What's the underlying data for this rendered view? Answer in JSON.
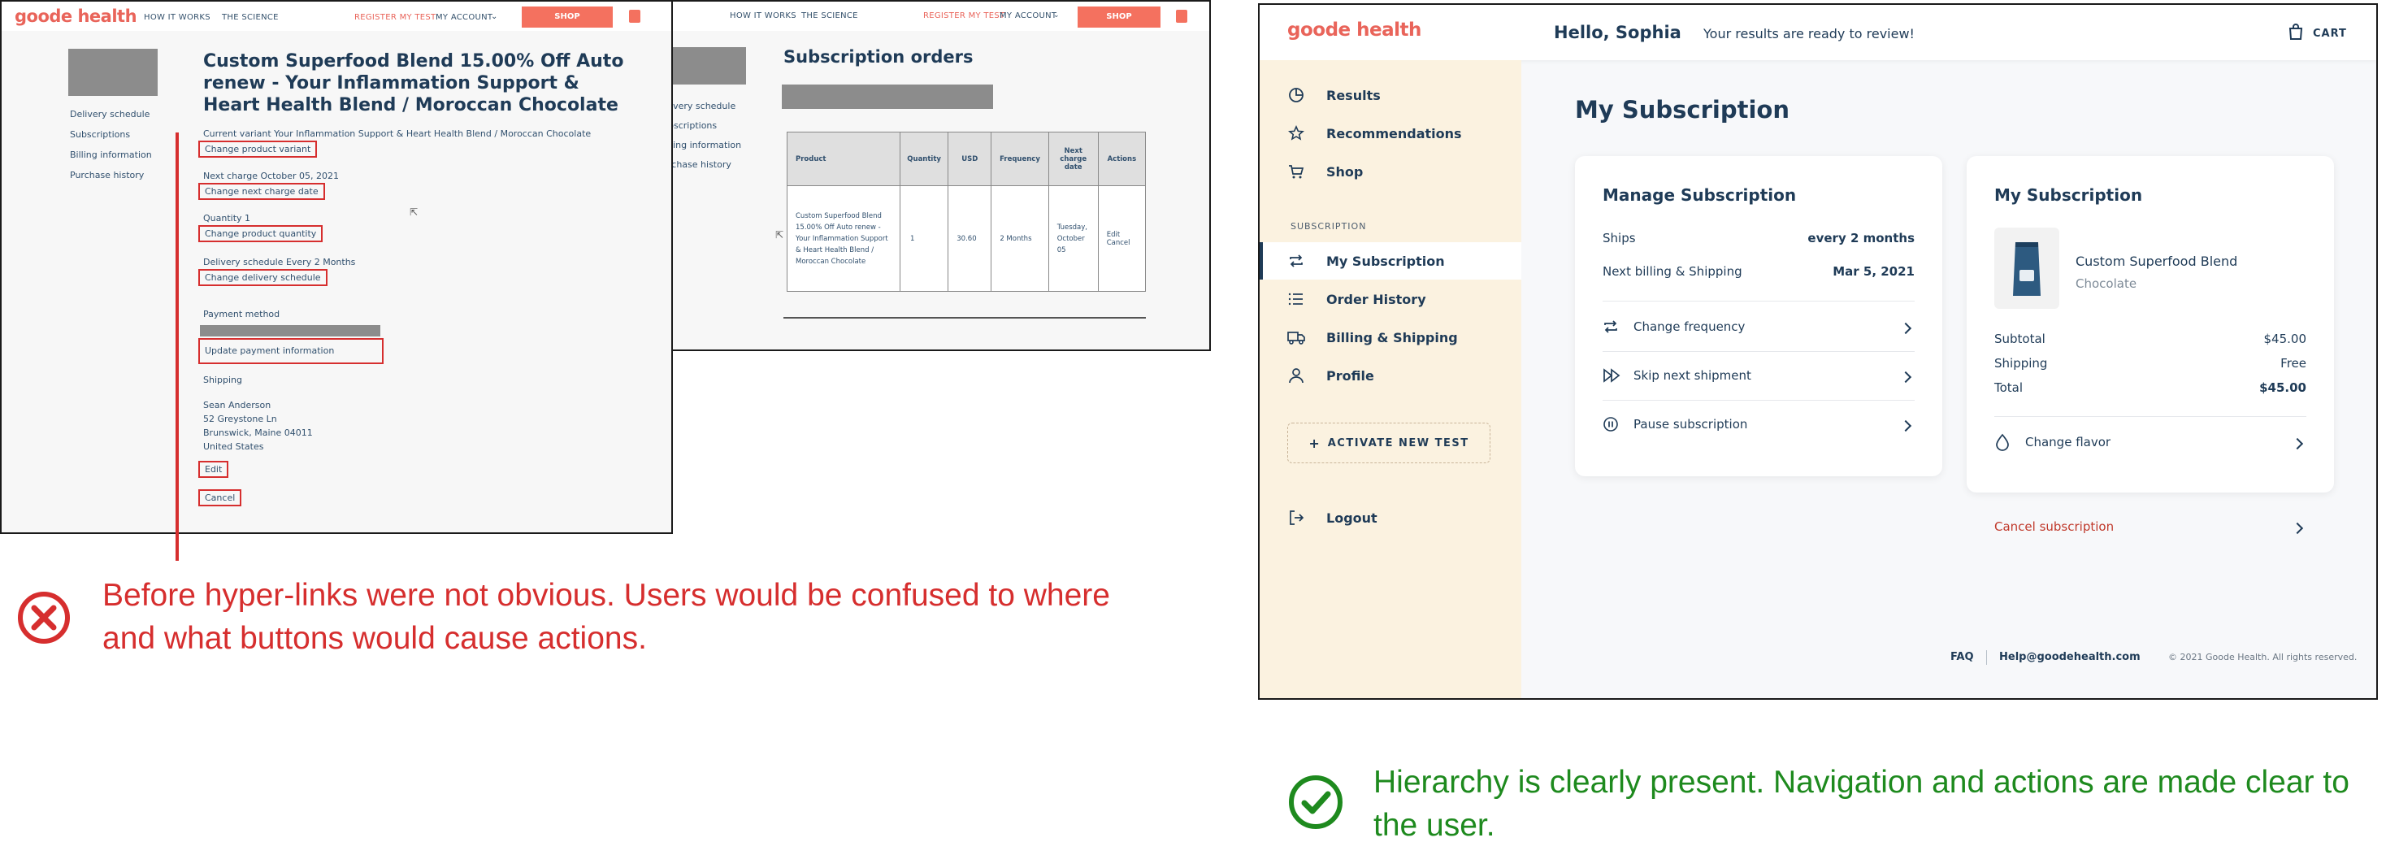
{
  "old_design": {
    "logo": "goode health",
    "nav": [
      "HOW IT WORKS",
      "THE SCIENCE"
    ],
    "register": "REGISTER MY TEST",
    "account": "MY ACCOUNT",
    "shop": "SHOP",
    "sidebar": [
      "Delivery schedule",
      "Subscriptions",
      "Billing information",
      "Purchase history"
    ],
    "sidebar_partial": [
      "livery schedule",
      "bscriptions",
      "lling information",
      "rchase history"
    ],
    "product_title": "Custom Superfood Blend 15.00% Off Auto renew - Your Inflammation Support & Heart Health Blend / Moroccan Chocolate",
    "current_variant": "Current variant Your Inflammation Support & Heart Health Blend / Moroccan Chocolate",
    "change_variant": "Change product variant",
    "next_charge": "Next charge October 05, 2021",
    "change_charge": "Change next charge date",
    "quantity": "Quantity 1",
    "change_quantity": "Change product quantity",
    "delivery": "Delivery schedule Every 2 Months",
    "change_delivery": "Change delivery schedule",
    "payment_label": "Payment method",
    "update_payment": "Update payment information",
    "shipping_label": "Shipping",
    "address": [
      "Sean Anderson",
      "52 Greystone Ln",
      "Brunswick, Maine 04011",
      "United States"
    ],
    "edit": "Edit",
    "cancel": "Cancel",
    "orders_title": "Subscription orders",
    "table": {
      "headers": [
        "Product",
        "Quantity",
        "USD",
        "Frequency",
        "Next charge date",
        "Actions"
      ],
      "row": {
        "product": "Custom Superfood Blend 15.00% Off Auto renew - Your Inflammation Support & Heart Health Blend / Moroccan Chocolate",
        "quantity": "1",
        "usd": "30.60",
        "frequency": "2 Months",
        "next_charge": "Tuesday, October 05",
        "action_edit": "Edit",
        "action_cancel": "Cancel"
      }
    },
    "caption": "Before hyper-links were not obvious. Users would be confused to where and what buttons would cause actions."
  },
  "new_design": {
    "logo": "goode health",
    "greeting": "Hello, Sophia",
    "results_msg": "Your results are ready to review!",
    "cart": "CART",
    "nav": {
      "results": "Results",
      "recommendations": "Recommendations",
      "shop": "Shop",
      "section": "SUBSCRIPTION",
      "my_subscription": "My Subscription",
      "order_history": "Order History",
      "billing": "Billing & Shipping",
      "profile": "Profile",
      "activate": "ACTIVATE NEW TEST",
      "logout": "Logout"
    },
    "page_title": "My Subscription",
    "manage": {
      "title": "Manage Subscription",
      "ships_label": "Ships",
      "ships_value": "every 2 months",
      "next_label": "Next billing & Shipping",
      "next_value": "Mar 5, 2021",
      "change_frequency": "Change frequency",
      "skip": "Skip next shipment",
      "pause": "Pause subscription"
    },
    "summary": {
      "title": "My Subscription",
      "product": "Custom Superfood Blend",
      "flavor": "Chocolate",
      "subtotal_label": "Subtotal",
      "subtotal": "$45.00",
      "shipping_label": "Shipping",
      "shipping": "Free",
      "total_label": "Total",
      "total": "$45.00",
      "change_flavor": "Change flavor",
      "cancel": "Cancel subscription"
    },
    "footer": {
      "faq": "FAQ",
      "help": "Help@goodehealth.com",
      "copyright": "© 2021 Goode Health. All rights reserved."
    },
    "caption": "Hierarchy is clearly present. Navigation and actions are made clear to the user."
  },
  "colors": {
    "brand": "#e9645a",
    "navy": "#1f3b57",
    "bad": "#d62e2e",
    "good": "#1e8a1e",
    "sidebar_bg": "#fbf2e0",
    "content_bg": "#f7f8fa"
  }
}
